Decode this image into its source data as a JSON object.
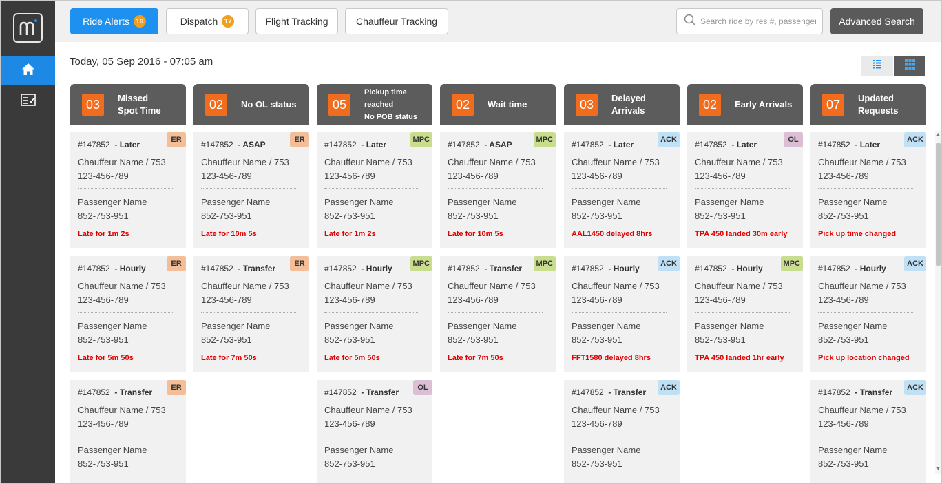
{
  "topbar": {
    "tabs": [
      {
        "label": "Ride Alerts",
        "badge": "19",
        "active": true
      },
      {
        "label": "Dispatch",
        "badge": "17",
        "active": false
      },
      {
        "label": "Flight Tracking",
        "badge": "",
        "active": false
      },
      {
        "label": "Chauffeur Tracking",
        "badge": "",
        "active": false
      }
    ],
    "search_placeholder": "Search ride by res #, passenger",
    "advanced_search_label": "Advanced Search"
  },
  "date_label": "Today, 05 Sep 2016 - 07:05 am",
  "sidebar": {
    "items": [
      {
        "icon": "home-icon",
        "active": true
      },
      {
        "icon": "checklist-icon",
        "active": false
      }
    ]
  },
  "colors": {
    "accent": "#1e90f0",
    "count_orange": "#f26c1e",
    "header_gray": "#5c5c5c",
    "alert_red": "#e00000",
    "tag_er": "#f3be98",
    "tag_mpc": "#c9dd8f",
    "tag_ack": "#bfe0f5",
    "tag_ol": "#dcbfd4"
  },
  "columns": [
    {
      "count": "03",
      "title": "Missed\nSpot Time",
      "cards": [
        {
          "id": "#147852",
          "type": "- Later",
          "tag": "ER",
          "chauffeur": "Chauffeur Name / 753",
          "chauffeur_phone": "123-456-789",
          "passenger": "Passenger Name",
          "passenger_phone": "852-753-951",
          "status": "Late for 1m 2s"
        },
        {
          "id": "#147852",
          "type": "- Hourly",
          "tag": "ER",
          "chauffeur": "Chauffeur Name / 753",
          "chauffeur_phone": "123-456-789",
          "passenger": "Passenger Name",
          "passenger_phone": "852-753-951",
          "status": "Late for 5m 50s"
        },
        {
          "id": "#147852",
          "type": "- Transfer",
          "tag": "ER",
          "chauffeur": "Chauffeur Name / 753",
          "chauffeur_phone": "123-456-789",
          "passenger": "Passenger Name",
          "passenger_phone": "852-753-951",
          "status": ""
        }
      ]
    },
    {
      "count": "02",
      "title": "No OL status",
      "cards": [
        {
          "id": "#147852",
          "type": "- ASAP",
          "tag": "ER",
          "chauffeur": "Chauffeur Name / 753",
          "chauffeur_phone": "123-456-789",
          "passenger": "Passenger Name",
          "passenger_phone": "852-753-951",
          "status": "Late for 10m 5s"
        },
        {
          "id": "#147852",
          "type": "- Transfer",
          "tag": "ER",
          "chauffeur": "Chauffeur Name / 753",
          "chauffeur_phone": "123-456-789",
          "passenger": "Passenger Name",
          "passenger_phone": "852-753-951",
          "status": "Late for 7m 50s"
        }
      ]
    },
    {
      "count": "05",
      "title": "Pickup time reached\nNo POB status",
      "cards": [
        {
          "id": "#147852",
          "type": "- Later",
          "tag": "MPC",
          "chauffeur": "Chauffeur Name / 753",
          "chauffeur_phone": "123-456-789",
          "passenger": "Passenger Name",
          "passenger_phone": "852-753-951",
          "status": "Late for 1m 2s"
        },
        {
          "id": "#147852",
          "type": "- Hourly",
          "tag": "MPC",
          "chauffeur": "Chauffeur Name / 753",
          "chauffeur_phone": "123-456-789",
          "passenger": "Passenger Name",
          "passenger_phone": "852-753-951",
          "status": "Late for 5m 50s"
        },
        {
          "id": "#147852",
          "type": "- Transfer",
          "tag": "OL",
          "chauffeur": "Chauffeur Name / 753",
          "chauffeur_phone": "123-456-789",
          "passenger": "Passenger Name",
          "passenger_phone": "852-753-951",
          "status": ""
        }
      ]
    },
    {
      "count": "02",
      "title": "Wait time",
      "cards": [
        {
          "id": "#147852",
          "type": "- ASAP",
          "tag": "MPC",
          "chauffeur": "Chauffeur Name / 753",
          "chauffeur_phone": "123-456-789",
          "passenger": "Passenger Name",
          "passenger_phone": "852-753-951",
          "status": "Late for 10m 5s"
        },
        {
          "id": "#147852",
          "type": "- Transfer",
          "tag": "MPC",
          "chauffeur": "Chauffeur Name / 753",
          "chauffeur_phone": "123-456-789",
          "passenger": "Passenger Name",
          "passenger_phone": "852-753-951",
          "status": "Late for 7m 50s"
        }
      ]
    },
    {
      "count": "03",
      "title": "Delayed\nArrivals",
      "cards": [
        {
          "id": "#147852",
          "type": "- Later",
          "tag": "ACK",
          "chauffeur": "Chauffeur Name / 753",
          "chauffeur_phone": "123-456-789",
          "passenger": "Passenger Name",
          "passenger_phone": "852-753-951",
          "status": "AAL1450 delayed 8hrs"
        },
        {
          "id": "#147852",
          "type": "- Hourly",
          "tag": "ACK",
          "chauffeur": "Chauffeur Name / 753",
          "chauffeur_phone": "123-456-789",
          "passenger": "Passenger Name",
          "passenger_phone": "852-753-951",
          "status": "FFT1580 delayed 8hrs"
        },
        {
          "id": "#147852",
          "type": "- Transfer",
          "tag": "ACK",
          "chauffeur": "Chauffeur Name / 753",
          "chauffeur_phone": "123-456-789",
          "passenger": "Passenger Name",
          "passenger_phone": "852-753-951",
          "status": ""
        }
      ]
    },
    {
      "count": "02",
      "title": "Early Arrivals",
      "cards": [
        {
          "id": "#147852",
          "type": "- Later",
          "tag": "OL",
          "chauffeur": "Chauffeur Name / 753",
          "chauffeur_phone": "123-456-789",
          "passenger": "Passenger Name",
          "passenger_phone": "852-753-951",
          "status": "TPA 450 landed 30m early"
        },
        {
          "id": "#147852",
          "type": "- Hourly",
          "tag": "MPC",
          "chauffeur": "Chauffeur Name / 753",
          "chauffeur_phone": "123-456-789",
          "passenger": "Passenger Name",
          "passenger_phone": "852-753-951",
          "status": "TPA 450 landed 1hr early"
        }
      ]
    },
    {
      "count": "07",
      "title": "Updated\nRequests",
      "cards": [
        {
          "id": "#147852",
          "type": "- Later",
          "tag": "ACK",
          "chauffeur": "Chauffeur Name / 753",
          "chauffeur_phone": "123-456-789",
          "passenger": "Passenger Name",
          "passenger_phone": "852-753-951",
          "status": "Pick up time changed"
        },
        {
          "id": "#147852",
          "type": "- Hourly",
          "tag": "ACK",
          "chauffeur": "Chauffeur Name / 753",
          "chauffeur_phone": "123-456-789",
          "passenger": "Passenger Name",
          "passenger_phone": "852-753-951",
          "status": "Pick up location changed"
        },
        {
          "id": "#147852",
          "type": "- Transfer",
          "tag": "ACK",
          "chauffeur": "Chauffeur Name / 753",
          "chauffeur_phone": "123-456-789",
          "passenger": "Passenger Name",
          "passenger_phone": "852-753-951",
          "status": ""
        }
      ]
    }
  ]
}
